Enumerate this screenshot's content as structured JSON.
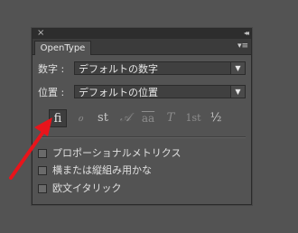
{
  "panel": {
    "title_close_icon": "×",
    "title_collapse_icon": "◂◂",
    "tab_label": "OpenType",
    "menu_icon": "▾≡"
  },
  "numbers_row": {
    "label": "数字 :",
    "value": "デフォルトの数字"
  },
  "position_row": {
    "label": "位置 :",
    "value": "デフォルトの位置"
  },
  "glyph_buttons": [
    "ﬁ",
    "ℴ",
    "st",
    "𝒜",
    "aa",
    "T",
    "1st",
    "½"
  ],
  "checkboxes": [
    {
      "label": "プロポーショナルメトリクス",
      "checked": false
    },
    {
      "label": "横または縦組み用かな",
      "checked": false
    },
    {
      "label": "欧文イタリック",
      "checked": false
    }
  ],
  "colors": {
    "background": "#535353",
    "panel_titlebar": "#2d2d2d",
    "annotation_arrow": "#e8141b"
  }
}
